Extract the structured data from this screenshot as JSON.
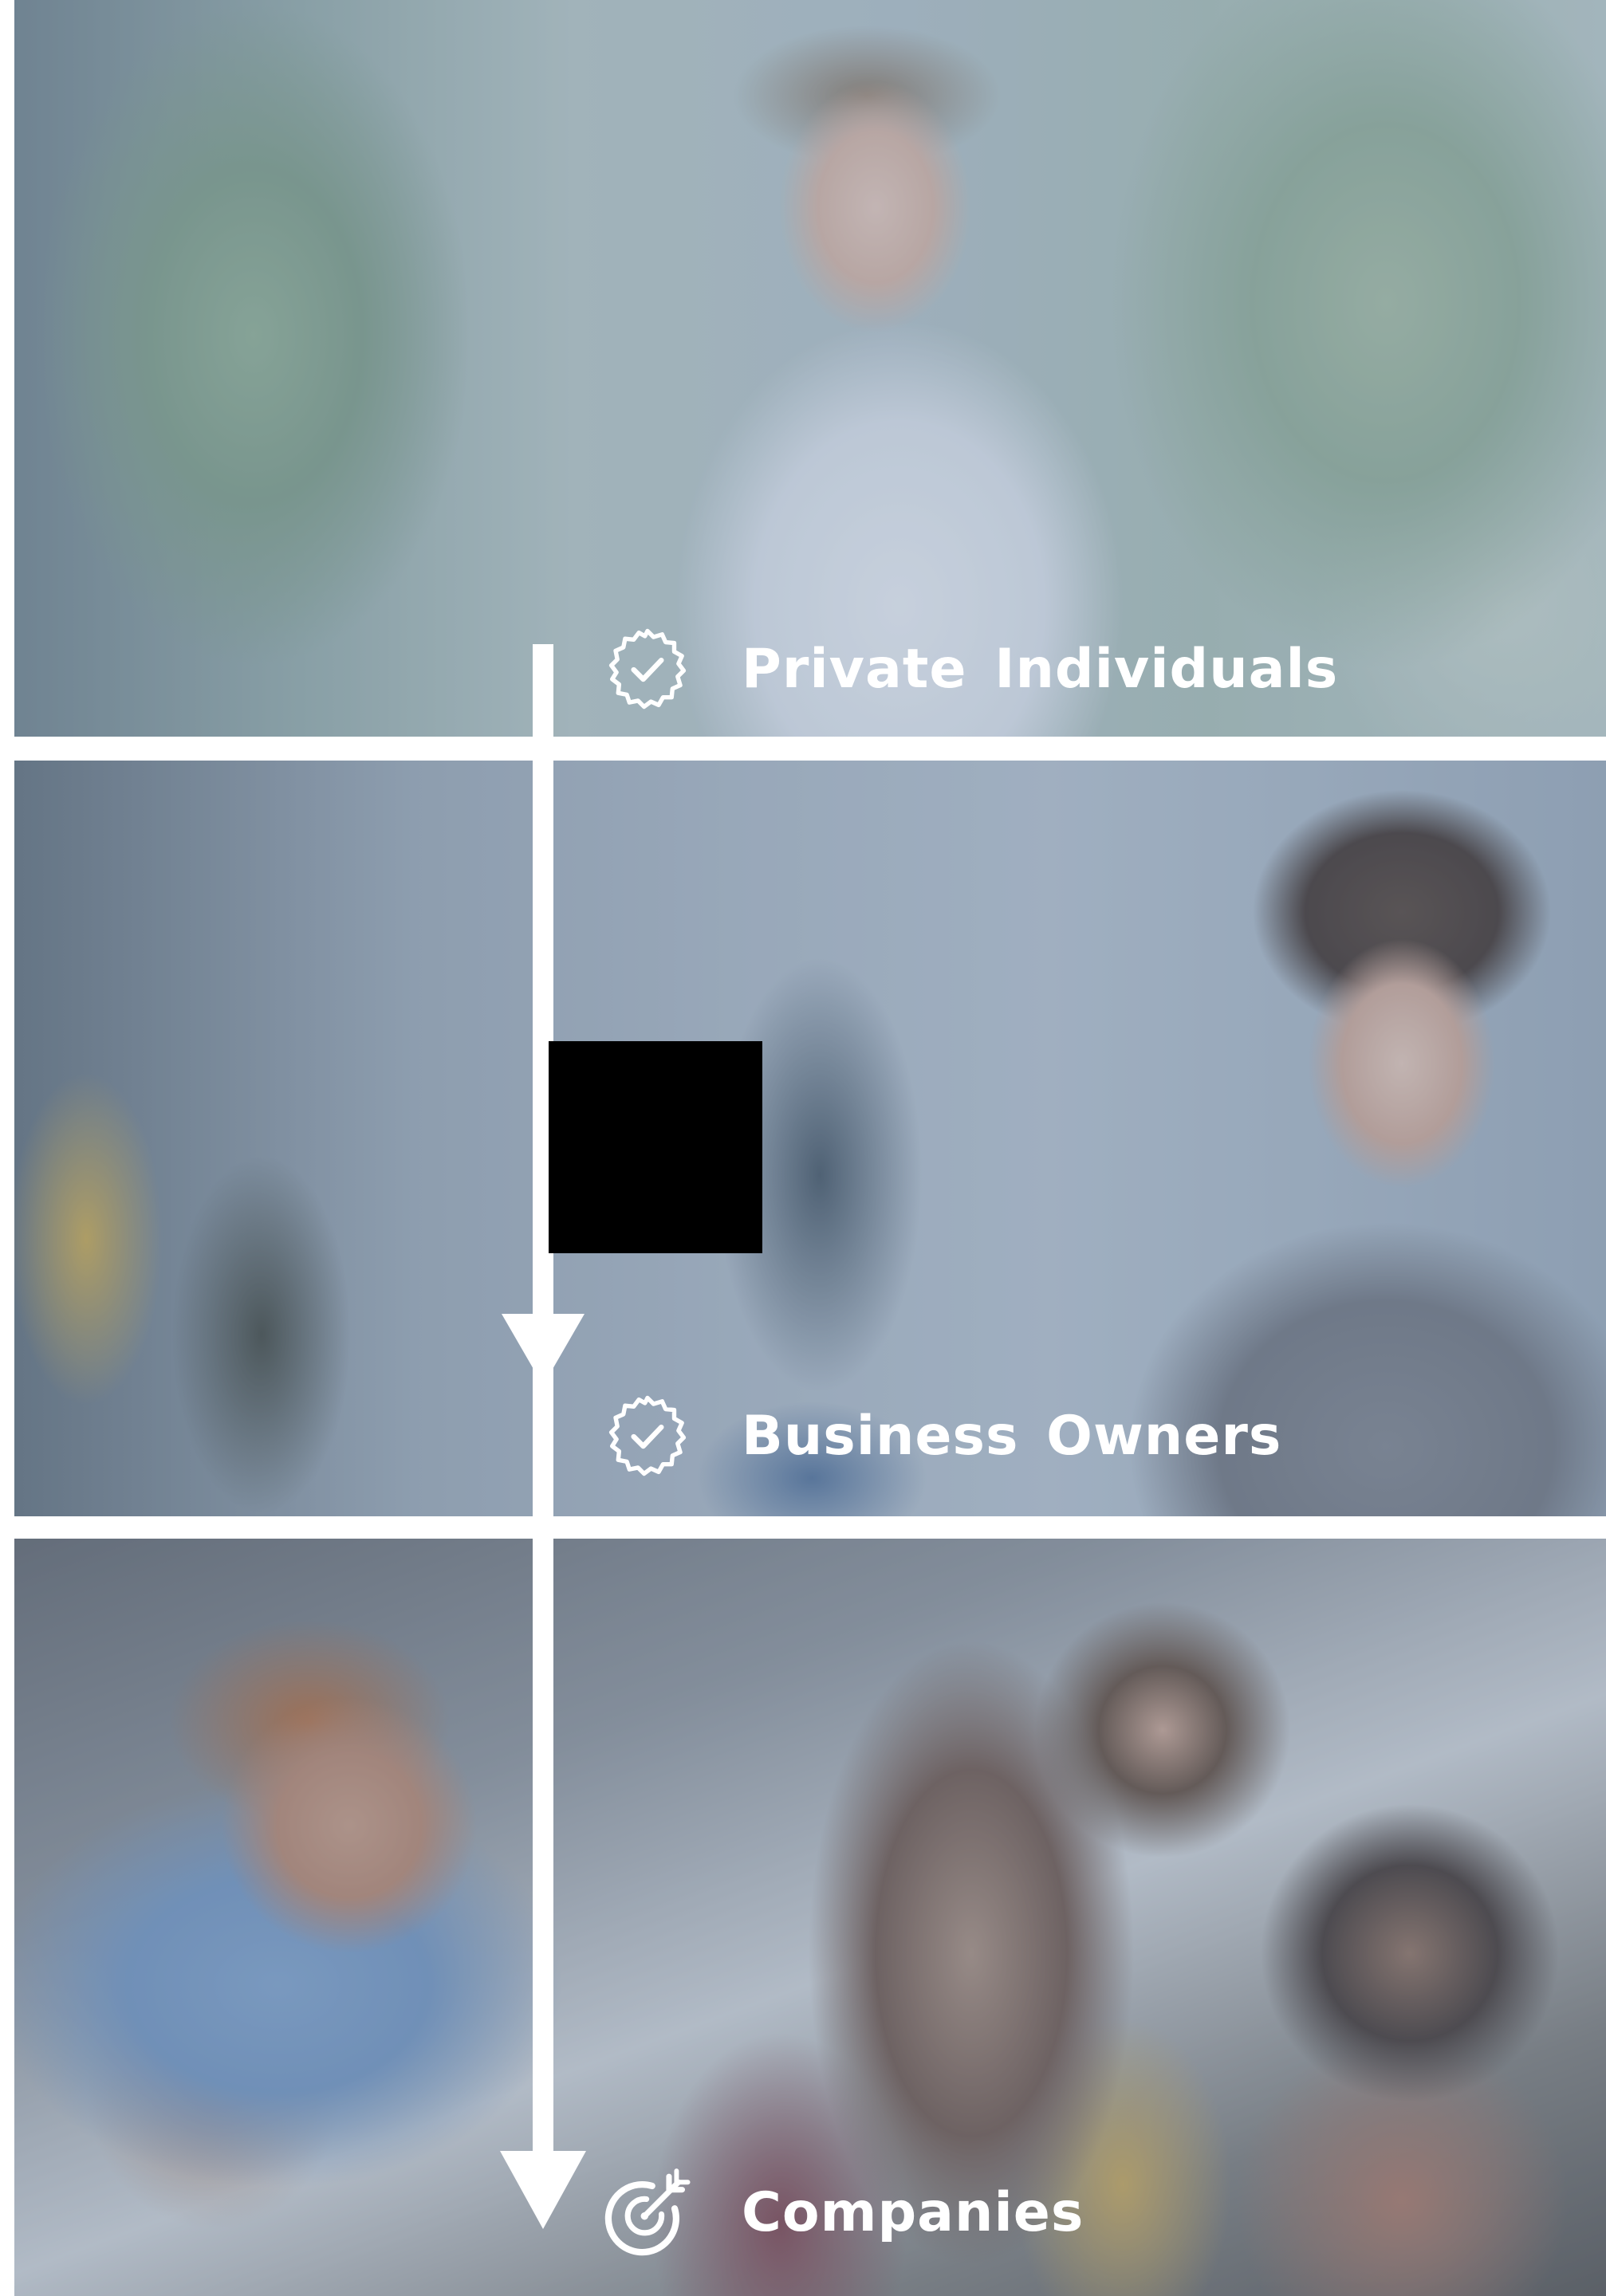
{
  "segments": [
    {
      "label": "Private Individuals",
      "icon": "verified-badge-icon"
    },
    {
      "label": "Business Owners",
      "icon": "verified-badge-icon"
    },
    {
      "label": "Companies",
      "icon": "target-arrow-icon"
    }
  ],
  "colors": {
    "text": "#ffffff",
    "arrow": "#ffffff",
    "overlay": "#748caa",
    "redaction": "#000000"
  }
}
